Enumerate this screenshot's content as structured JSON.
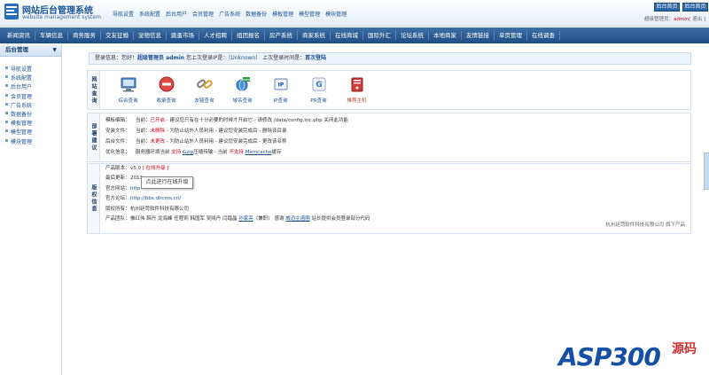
{
  "header": {
    "title": "网站后台管理系统",
    "subtitle": "website management system",
    "top_menu": [
      "导航设置",
      "系统配置",
      "后台用户",
      "会员管理",
      "广告系统",
      "数据备份",
      "模板管理",
      "模型管理",
      "模块管理"
    ],
    "btn_home": "后台首页",
    "btn_site": "后台首页",
    "user_prefix": "超级管理员：",
    "user_name": "admin",
    "user_suffix": "[ 退出 ]"
  },
  "nav": [
    "新闻资讯",
    "车辆信息",
    "商务服务",
    "交友征婚",
    "宠物信息",
    "跳蚤市场",
    "人才招聘",
    "组团报名",
    "房产系统",
    "商家系统",
    "在线商城",
    "国际外汇",
    "论坛系统",
    "本地商家",
    "友情链接",
    "单页管理",
    "在线调查"
  ],
  "sidebar": {
    "title": "后台管理",
    "items": [
      "导航设置",
      "系统配置",
      "后台用户",
      "会员管理",
      "广告系统",
      "数据备份",
      "模板管理",
      "模型管理",
      "模块管理"
    ]
  },
  "login": {
    "prefix": "登录信息：您好！",
    "role": "超级管理员 admin",
    "mid": "您上次登录IP是：",
    "ip": "（Unknown）",
    "mid2": "上次登录时间是：",
    "time": "首次登陆"
  },
  "query": {
    "label": "网站查询",
    "tools": [
      {
        "label": "综合查询",
        "icon": "computer-icon"
      },
      {
        "label": "收录查询",
        "icon": "stop-icon"
      },
      {
        "label": "友链查询",
        "icon": "chain-icon"
      },
      {
        "label": "域名查询",
        "icon": "globe-icon"
      },
      {
        "label": "IP查询",
        "icon": "ip-icon"
      },
      {
        "label": "PR查询",
        "icon": "google-icon"
      },
      {
        "label": "推荐主机",
        "icon": "server-icon"
      }
    ]
  },
  "security": {
    "label": "部署建议",
    "rows": [
      {
        "k": "模板编辑：",
        "a": "当前：",
        "b": "已开启",
        "c": " - 建议您只有在十分必要的时候才开启它 - 请修改 /data/config.inc.php 关闭此功能"
      },
      {
        "k": "安装文件：",
        "a": "当前：",
        "b": "未删除",
        "c": " - 为防止站外人员利用 - 建议您安装完成后 - 删除该目录"
      },
      {
        "k": "后台文件：",
        "a": "当前：",
        "b": "未更改",
        "c": " - 为防止站外人员利用 - 建议您安装完成后 - 更改该名称"
      },
      {
        "k": "优化信息：",
        "a": "服务器环境当前 ",
        "b": "支持",
        "g": "Gzip",
        "c": "压缩传输 - 当前 ",
        "d": "不支持",
        "m": "Memcache",
        "e": "缓存"
      }
    ]
  },
  "version": {
    "label": "版权信息",
    "product_version_k": "产品版本：",
    "product_version_v": "v5.0",
    "product_version_link": "[ 在线升级 ]",
    "update_k": "最后更新：",
    "update_v": "2013",
    "site_k": "官方网站：",
    "site_v": "http",
    "forum_k": "官方论坛：",
    "forum_v": "http://bbs.dircms.cn/",
    "owner_k": "版权所有：",
    "owner_v": "杭州廷菏软件科技有限公司",
    "team_k": "产品团队：",
    "team_v": "佛红伟  韩丹  龙海峰  任程莉  韩国军  吴晓丹  闫踏晶",
    "team_v2": "孙家亮",
    "team_v3": "（兼职）  感谢",
    "team_v4": "威迈主函圈",
    "team_v5": "站长提供会员登录部分代码",
    "copyright": "杭州廷菏软件科技有限公司 旗下产品"
  },
  "tooltip": "点此进行在线升级",
  "watermark": {
    "text": "ASP300",
    "cn": "源码"
  },
  "colors": {
    "brand": "#1f5497",
    "nav": "#2b5c96",
    "alert": "#d0021b"
  }
}
